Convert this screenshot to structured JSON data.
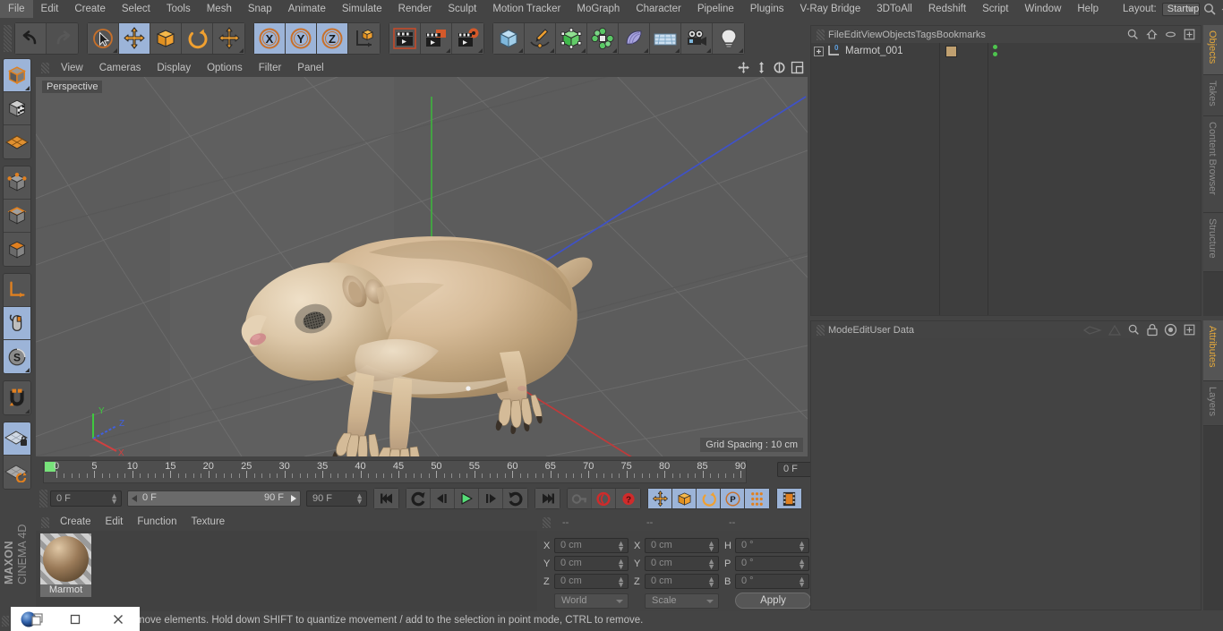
{
  "app": {
    "title": "MAXON CINEMA 4D",
    "brand_line1": "MAXON",
    "brand_line2": "CINEMA 4D"
  },
  "menubar": {
    "items": [
      {
        "label": "File"
      },
      {
        "label": "Edit"
      },
      {
        "label": "Create"
      },
      {
        "label": "Select"
      },
      {
        "label": "Tools"
      },
      {
        "label": "Mesh"
      },
      {
        "label": "Snap"
      },
      {
        "label": "Animate"
      },
      {
        "label": "Simulate"
      },
      {
        "label": "Render"
      },
      {
        "label": "Sculpt"
      },
      {
        "label": "Motion Tracker"
      },
      {
        "label": "MoGraph"
      },
      {
        "label": "Character"
      },
      {
        "label": "Pipeline"
      },
      {
        "label": "Plugins"
      },
      {
        "label": "V-Ray Bridge"
      },
      {
        "label": "3DToAll"
      },
      {
        "label": "Redshift"
      },
      {
        "label": "Script"
      },
      {
        "label": "Window"
      },
      {
        "label": "Help"
      }
    ],
    "layout_label": "Layout:",
    "layout_value": "Startup",
    "right_icons": [
      "search-icon",
      "home-icon",
      "ellipse-icon",
      "plus-box-icon"
    ]
  },
  "toolbar": {
    "groups": [
      {
        "name": "history",
        "buttons": [
          {
            "name": "undo-button",
            "icon": "undo-arrow-icon",
            "state": "normal"
          },
          {
            "name": "redo-button",
            "icon": "redo-arrow-icon",
            "state": "disabled"
          }
        ]
      },
      {
        "name": "tools",
        "buttons": [
          {
            "name": "live-selection-button",
            "icon": "cursor-circle-icon",
            "state": "normal",
            "corner": true
          },
          {
            "name": "move-tool-button",
            "icon": "move-arrows-icon",
            "state": "active"
          },
          {
            "name": "scale-tool-button",
            "icon": "scale-box-icon",
            "state": "normal"
          },
          {
            "name": "rotate-tool-button",
            "icon": "rotate-arc-icon",
            "state": "normal"
          },
          {
            "name": "move-duplicate-button",
            "icon": "move-arrows-icon",
            "state": "normal",
            "corner": true
          }
        ]
      },
      {
        "name": "axis-locks",
        "buttons": [
          {
            "name": "x-axis-lock-button",
            "icon": "x-axis-icon",
            "state": "active"
          },
          {
            "name": "y-axis-lock-button",
            "icon": "y-axis-icon",
            "state": "active"
          },
          {
            "name": "z-axis-lock-button",
            "icon": "z-axis-icon",
            "state": "active"
          },
          {
            "name": "world-coordinate-button",
            "icon": "world-axis-cube-icon",
            "state": "normal"
          }
        ]
      },
      {
        "name": "render",
        "buttons": [
          {
            "name": "render-view-button",
            "icon": "clapper-frame-icon",
            "state": "normal"
          },
          {
            "name": "render-to-picture-viewer-button",
            "icon": "clapper-picture-icon",
            "state": "normal",
            "corner": true
          },
          {
            "name": "render-settings-button",
            "icon": "clapper-gear-icon",
            "state": "normal",
            "corner": true
          }
        ]
      },
      {
        "name": "objects",
        "buttons": [
          {
            "name": "add-cube-button",
            "icon": "blue-cube-icon",
            "state": "normal",
            "corner": true
          },
          {
            "name": "add-spline-button",
            "icon": "pen-spline-icon",
            "state": "normal",
            "corner": true
          },
          {
            "name": "add-generator-button",
            "icon": "green-cube-points-icon",
            "state": "normal",
            "corner": true
          },
          {
            "name": "add-array-button",
            "icon": "green-cluster-icon",
            "state": "normal",
            "corner": true
          },
          {
            "name": "add-deformer-button",
            "icon": "purple-bend-icon",
            "state": "normal",
            "corner": true
          },
          {
            "name": "add-floor-button",
            "icon": "grid-floor-icon",
            "state": "normal",
            "corner": true
          },
          {
            "name": "add-camera-button",
            "icon": "camera-icon",
            "state": "normal",
            "corner": true
          },
          {
            "name": "add-light-button",
            "icon": "lightbulb-icon",
            "state": "normal",
            "corner": true
          }
        ]
      }
    ]
  },
  "left_toolbar": {
    "groups": [
      {
        "buttons": [
          {
            "name": "model-mode-button",
            "icon": "model-cube-icon",
            "state": "active",
            "corner": true
          },
          {
            "name": "texture-mode-button",
            "icon": "texture-cube-icon",
            "state": "normal"
          },
          {
            "name": "deformed-mode-button",
            "icon": "deformed-mesh-icon",
            "state": "normal"
          }
        ]
      },
      {
        "buttons": [
          {
            "name": "point-mode-button",
            "icon": "point-cube-icon",
            "state": "normal"
          },
          {
            "name": "edge-mode-button",
            "icon": "edge-cube-icon",
            "state": "normal"
          },
          {
            "name": "polygon-mode-button",
            "icon": "polygon-cube-icon",
            "state": "normal"
          }
        ]
      },
      {
        "buttons": [
          {
            "name": "axis-modify-button",
            "icon": "axis-arrow-icon",
            "state": "normal"
          },
          {
            "name": "enable-snapping-button",
            "icon": "mouse-snap-icon",
            "state": "active"
          },
          {
            "name": "soft-selection-button",
            "icon": "soft-selection-s-icon",
            "state": "active",
            "corner": true
          }
        ]
      },
      {
        "buttons": [
          {
            "name": "magnet-tool-button",
            "icon": "magnet-icon",
            "state": "normal",
            "corner": true
          }
        ]
      },
      {
        "buttons": [
          {
            "name": "lock-workplane-button",
            "icon": "workplane-lock-icon",
            "state": "active"
          },
          {
            "name": "workplane-rotate-button",
            "icon": "workplane-rotate-icon",
            "state": "normal"
          }
        ]
      }
    ]
  },
  "viewport": {
    "menu": [
      {
        "label": "View"
      },
      {
        "label": "Cameras"
      },
      {
        "label": "Display"
      },
      {
        "label": "Options"
      },
      {
        "label": "Filter"
      },
      {
        "label": "Panel"
      }
    ],
    "nav_icons": [
      "pan-icon",
      "dolly-icon",
      "rotate-view-icon",
      "maximize-view-icon"
    ],
    "label": "Perspective",
    "grid_spacing": "Grid Spacing : 10 cm",
    "axis_gizmo": {
      "x": "X",
      "y": "Y",
      "z": "Z",
      "x_color": "#e04040",
      "y_color": "#40c840",
      "z_color": "#4060e0"
    },
    "background_color": "#5c5c5c",
    "model_name": "Marmot"
  },
  "timeline": {
    "ticks": [
      0,
      5,
      10,
      15,
      20,
      25,
      30,
      35,
      40,
      45,
      50,
      55,
      60,
      65,
      70,
      75,
      80,
      85,
      90
    ],
    "current_frame_field": "0 F",
    "playhead_frame": 0,
    "range_min": 90,
    "range_max": 0
  },
  "transport": {
    "current_frame": "0 F",
    "range_start": "0 F",
    "range_end": "90 F",
    "max_frame": "90 F",
    "buttons": [
      {
        "name": "go-to-start-button",
        "icon": "skip-start-icon",
        "state": "normal"
      },
      {
        "name": "play-backwards-loop-button",
        "icon": "loop-back-icon",
        "state": "normal"
      },
      {
        "name": "previous-frame-button",
        "icon": "step-back-icon",
        "state": "normal"
      },
      {
        "name": "play-button",
        "icon": "play-icon",
        "state": "normal"
      },
      {
        "name": "next-frame-button",
        "icon": "step-forward-icon",
        "state": "normal"
      },
      {
        "name": "play-forwards-loop-button",
        "icon": "loop-forward-icon",
        "state": "normal"
      },
      {
        "name": "go-to-end-button",
        "icon": "skip-end-icon",
        "state": "normal"
      },
      {
        "name": "record-active-objects-button",
        "icon": "key-icon",
        "state": "disabled"
      },
      {
        "name": "autokeying-button",
        "icon": "red-circle-icon",
        "state": "normal"
      },
      {
        "name": "keyframe-selection-button",
        "icon": "red-question-icon",
        "state": "normal"
      },
      {
        "name": "position-key-button",
        "icon": "move-arrows-icon",
        "state": "active"
      },
      {
        "name": "scale-key-button",
        "icon": "scale-box-icon",
        "state": "active"
      },
      {
        "name": "rotation-key-button",
        "icon": "rotate-arc-icon",
        "state": "active"
      },
      {
        "name": "parameter-key-button",
        "icon": "p-circle-icon",
        "state": "active"
      },
      {
        "name": "point-level-animation-button",
        "icon": "dot-matrix-icon",
        "state": "active"
      },
      {
        "name": "timeline-toggle-button",
        "icon": "filmstrip-icon",
        "state": "active"
      }
    ]
  },
  "material_manager": {
    "menu": [
      {
        "label": "Create"
      },
      {
        "label": "Edit"
      },
      {
        "label": "Function"
      },
      {
        "label": "Texture"
      }
    ],
    "materials": [
      {
        "name": "Marmot",
        "color": "#9a7a58"
      }
    ]
  },
  "coordinates": {
    "header": [
      "--",
      "--",
      "--"
    ],
    "position": {
      "label_x": "X",
      "label_y": "Y",
      "label_z": "Z",
      "x": "0 cm",
      "y": "0 cm",
      "z": "0 cm"
    },
    "size": {
      "label_x": "X",
      "label_y": "Y",
      "label_z": "Z",
      "x": "0 cm",
      "y": "0 cm",
      "z": "0 cm"
    },
    "rotation": {
      "label_h": "H",
      "label_p": "P",
      "label_b": "B",
      "h": "0 °",
      "p": "0 °",
      "b": "0 °"
    },
    "system": "World",
    "mode": "Scale",
    "apply_label": "Apply"
  },
  "object_manager": {
    "menu": [
      {
        "label": "File"
      },
      {
        "label": "Edit"
      },
      {
        "label": "View"
      },
      {
        "label": "Objects"
      },
      {
        "label": "Tags"
      },
      {
        "label": "Bookmarks"
      }
    ],
    "icons": [
      "search-icon",
      "home-icon",
      "ellipse-icon",
      "plus-box-icon"
    ],
    "objects": [
      {
        "name": "Marmot_001",
        "layer_badge": "0",
        "tag_color": "#c0a070",
        "visibility_dot_top": "#4ec44e",
        "visibility_dot_bottom": "#4ec44e"
      }
    ]
  },
  "attribute_manager": {
    "menu": [
      {
        "label": "Mode"
      },
      {
        "label": "Edit"
      },
      {
        "label": "User Data"
      }
    ],
    "icons": [
      "prev-nav-icon",
      "up-nav-icon",
      "search-icon",
      "lock-icon",
      "target-icon",
      "plus-box-icon"
    ]
  },
  "vertical_tabs_top": [
    {
      "label": "Objects",
      "active": true
    },
    {
      "label": "Takes",
      "active": false
    },
    {
      "label": "Content Browser",
      "active": false
    },
    {
      "label": "Structure",
      "active": false
    }
  ],
  "vertical_tabs_bottom": [
    {
      "label": "Attributes",
      "active": true
    },
    {
      "label": "Layers",
      "active": false
    }
  ],
  "status_bar": {
    "text": "move elements. Hold down SHIFT to quantize movement / add to the selection in point mode, CTRL to remove."
  },
  "window_controls": {
    "app_icon": "c4d-sphere-icon",
    "minimize": "minimize-icon",
    "maximize": "maximize-icon",
    "close": "close-icon"
  },
  "colors": {
    "panel_bg": "#444444",
    "viewport_bg": "#5c5c5c",
    "accent_active": "#9cb4d8",
    "tab_active_text": "#e3a83c",
    "playhead_green": "#77e27a"
  }
}
